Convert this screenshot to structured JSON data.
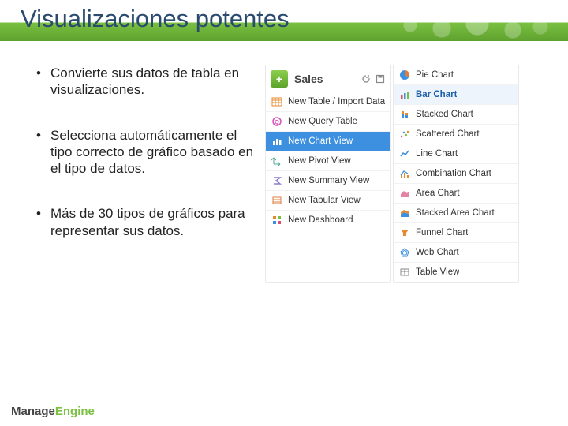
{
  "title": "Visualizaciones potentes",
  "bullets": [
    "Convierte sus datos de tabla en visualizaciones.",
    "Selecciona automáticamente el tipo correcto de gráfico basado en el tipo de datos.",
    "Más de 30 tipos de gráficos para representar sus datos."
  ],
  "create_panel": {
    "title": "Sales",
    "items": [
      {
        "label": "New Table / Import Data",
        "icon": "table-icon",
        "selected": false
      },
      {
        "label": "New Query Table",
        "icon": "query-icon",
        "selected": false
      },
      {
        "label": "New Chart View",
        "icon": "chart-icon",
        "selected": true
      },
      {
        "label": "New Pivot View",
        "icon": "pivot-icon",
        "selected": false
      },
      {
        "label": "New Summary View",
        "icon": "summary-icon",
        "selected": false
      },
      {
        "label": "New Tabular View",
        "icon": "tabular-icon",
        "selected": false
      },
      {
        "label": "New Dashboard",
        "icon": "dashboard-icon",
        "selected": false
      }
    ]
  },
  "chart_types": {
    "items": [
      {
        "label": "Pie Chart",
        "icon": "pie-chart-icon",
        "selected": false
      },
      {
        "label": "Bar Chart",
        "icon": "bar-chart-icon",
        "selected": true
      },
      {
        "label": "Stacked Chart",
        "icon": "stacked-chart-icon",
        "selected": false
      },
      {
        "label": "Scattered Chart",
        "icon": "scatter-chart-icon",
        "selected": false
      },
      {
        "label": "Line Chart",
        "icon": "line-chart-icon",
        "selected": false
      },
      {
        "label": "Combination Chart",
        "icon": "combination-chart-icon",
        "selected": false
      },
      {
        "label": "Area Chart",
        "icon": "area-chart-icon",
        "selected": false
      },
      {
        "label": "Stacked Area Chart",
        "icon": "stacked-area-chart-icon",
        "selected": false
      },
      {
        "label": "Funnel Chart",
        "icon": "funnel-chart-icon",
        "selected": false
      },
      {
        "label": "Web Chart",
        "icon": "web-chart-icon",
        "selected": false
      },
      {
        "label": "Table View",
        "icon": "table-view-icon",
        "selected": false
      }
    ]
  },
  "footer": {
    "brand_m": "Manage",
    "brand_e": "Engine"
  }
}
